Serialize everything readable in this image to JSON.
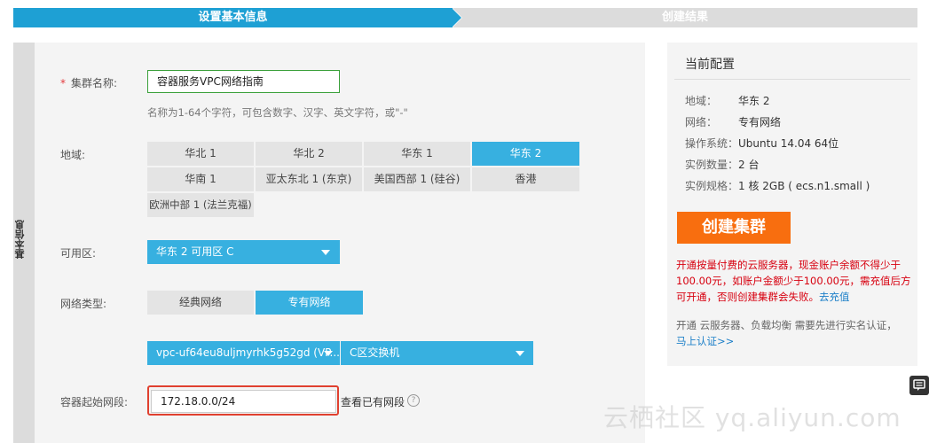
{
  "steps": {
    "step1": "设置基本信息",
    "step2": "创建结果"
  },
  "side_tab_label": "基本信息",
  "cluster_name": {
    "label": "集群名称:",
    "required_mark": "*",
    "value": "容器服务VPC网络指南",
    "hint": "名称为1-64个字符，可包含数字、汉字、英文字符，或\"-\""
  },
  "region": {
    "label": "地域:",
    "options": [
      "华北 1",
      "华北 2",
      "华东 1",
      "华东 2",
      "华南 1",
      "亚太东北 1 (东京)",
      "美国西部 1 (硅谷)",
      "香港",
      "欧洲中部 1 (法兰克福)"
    ],
    "selected": "华东 2"
  },
  "zone": {
    "label": "可用区:",
    "value": "华东 2 可用区 C"
  },
  "network_type": {
    "label": "网络类型:",
    "options": [
      "经典网络",
      "专有网络"
    ],
    "selected": "专有网络"
  },
  "vpc": {
    "vpc_value": "vpc-uf64eu8uljmyrhk5g52gd (VP...",
    "vswitch_value": "C区交换机"
  },
  "container_cidr": {
    "label": "容器起始网段:",
    "value": "172.18.0.0/24",
    "view_link": "查看已有网段",
    "help_glyph": "?"
  },
  "config": {
    "title": "当前配置",
    "rows": [
      {
        "key": "地域：",
        "value": "华东 2"
      },
      {
        "key": "网络：",
        "value": "专有网络"
      },
      {
        "key": "操作系统：",
        "value": "Ubuntu 14.04 64位"
      },
      {
        "key": "实例数量：",
        "value": "2 台"
      },
      {
        "key": "实例规格：",
        "value": "1 核 2GB ( ecs.n1.small )"
      }
    ],
    "create_button": "创建集群",
    "warning": "开通按量付费的云服务器，现金账户余额不得少于100.00元，如账户金额少于100.00元，需充值后方可开通，否则创建集群会失败。",
    "recharge_link": "去充值",
    "note": "开通 云服务器、负载均衡 需要先进行实名认证，",
    "verify_link": "马上认证>>"
  },
  "watermark": "云栖社区 yq.aliyun.com",
  "colors": {
    "accent": "#37b0e0",
    "step_active": "#1ea0d4",
    "create_button": "#f86e0f",
    "warning": "#d7000f",
    "highlight": "#e0402f"
  }
}
